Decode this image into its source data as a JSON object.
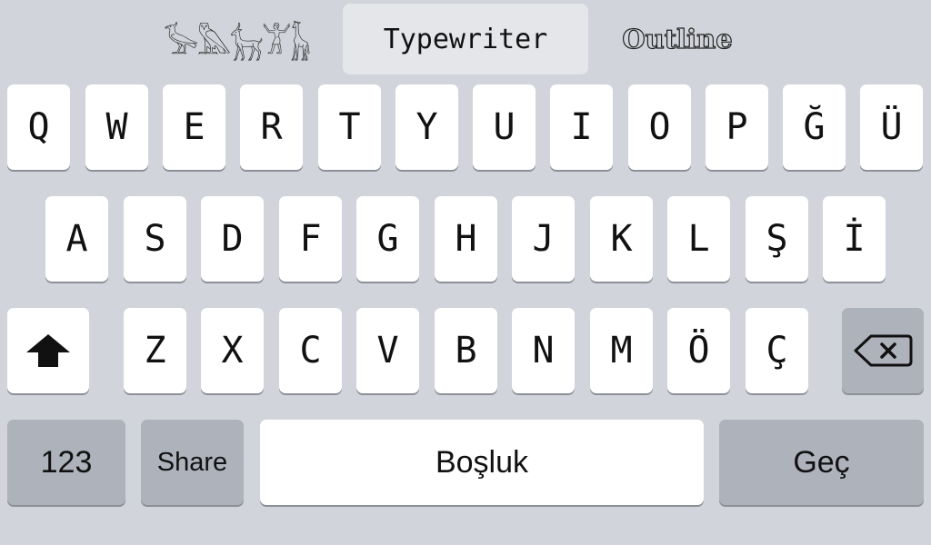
{
  "font_bar": {
    "hieroglyph_tab": "𓅚𓅓𓃴𓀠𓃱",
    "typewriter_tab": "Typewriter",
    "outline_tab": "Outline",
    "selected": "Typewriter"
  },
  "keys": {
    "row1": [
      "Q",
      "W",
      "E",
      "R",
      "T",
      "Y",
      "U",
      "I",
      "O",
      "P",
      "Ğ",
      "Ü"
    ],
    "row2": [
      "A",
      "S",
      "D",
      "F",
      "G",
      "H",
      "J",
      "K",
      "L",
      "Ş",
      "İ"
    ],
    "row3": [
      "Z",
      "X",
      "C",
      "V",
      "B",
      "N",
      "M",
      "Ö",
      "Ç"
    ]
  },
  "bottom_row": {
    "numbers": "123",
    "share": "Share",
    "space": "Boşluk",
    "go": "Geç"
  },
  "icons": {
    "shift": "shift-arrow-icon",
    "delete": "backspace-icon"
  },
  "colors": {
    "background": "#d1d4da",
    "key": "#ffffff",
    "function_key": "#adb2bb",
    "selected_tab": "#e4e6ea"
  }
}
